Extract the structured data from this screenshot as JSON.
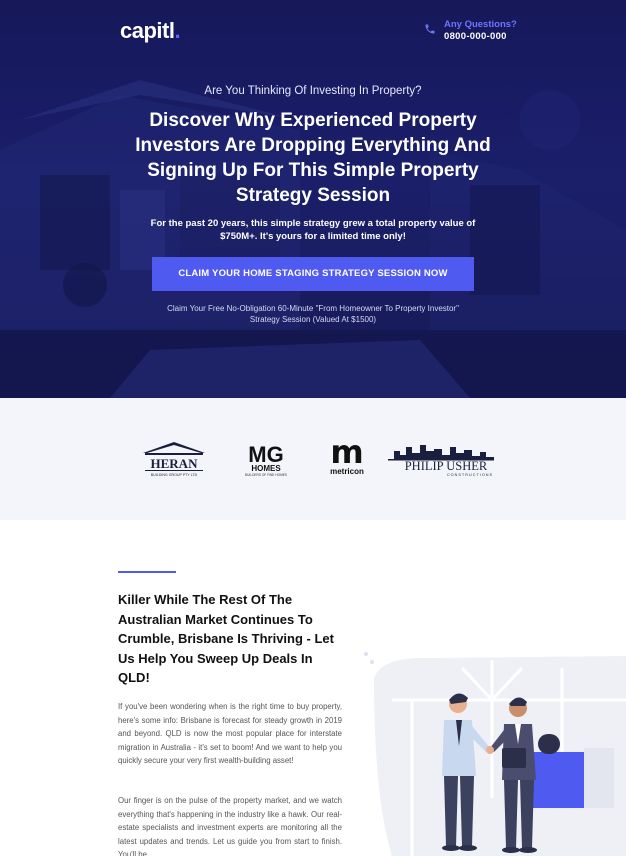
{
  "header": {
    "logo_text": "capitl",
    "logo_dot": ".",
    "contact_question": "Any Questions?",
    "contact_phone": "0800-000-000",
    "phone_icon": "phone-icon"
  },
  "hero": {
    "eyebrow": "Are You Thinking Of Investing In Property?",
    "title": "Discover Why Experienced Property Investors Are Dropping Everything And Signing Up For This Simple Property Strategy Session",
    "subtitle": "For the past 20 years, this simple strategy grew a total property value of $750M+. It's yours for a limited time only!",
    "cta_label": "CLAIM YOUR HOME STAGING STRATEGY SESSION NOW",
    "cta_note": "Claim Your Free No-Obligation 60-Minute  \"From Homeowner To Property Investor\" Strategy Session  (Valued At $1500)"
  },
  "logos": {
    "heran": {
      "name": "HERAN",
      "tagline": "BUILDING GROUP PTY LTD"
    },
    "mg": {
      "name": "MG",
      "sub": "HOMES",
      "tagline": "BUILDERS OF FINE HOMES"
    },
    "metricon": {
      "mark": "m",
      "name": "metricon"
    },
    "philip": {
      "name": "PHILIP USHER",
      "tagline": "CONSTRUCTIONS"
    }
  },
  "content": {
    "headline": "Killer While The Rest Of The Australian Market Continues To Crumble, Brisbane Is Thriving - Let Us Help You Sweep Up Deals In QLD!",
    "para1": "If you've been wondering when is the right time to buy property, here's some info: Brisbane is forecast for steady growth in 2019 and beyond. QLD is now the most popular place for interstate migration in Australia - it's set to boom! And we want to help you quickly secure your very first wealth-building asset!",
    "para2": "Our finger is on the pulse of the property market, and we watch everything that's happening in the industry like a hawk. Our real-estate specialists and investment experts are monitoring all the latest updates and trends. Let us guide you from start to finish. You'll be"
  },
  "colors": {
    "accent": "#4f5bf0",
    "hero_bg": "#1b1f6a",
    "strip_bg": "#f4f5fa"
  }
}
